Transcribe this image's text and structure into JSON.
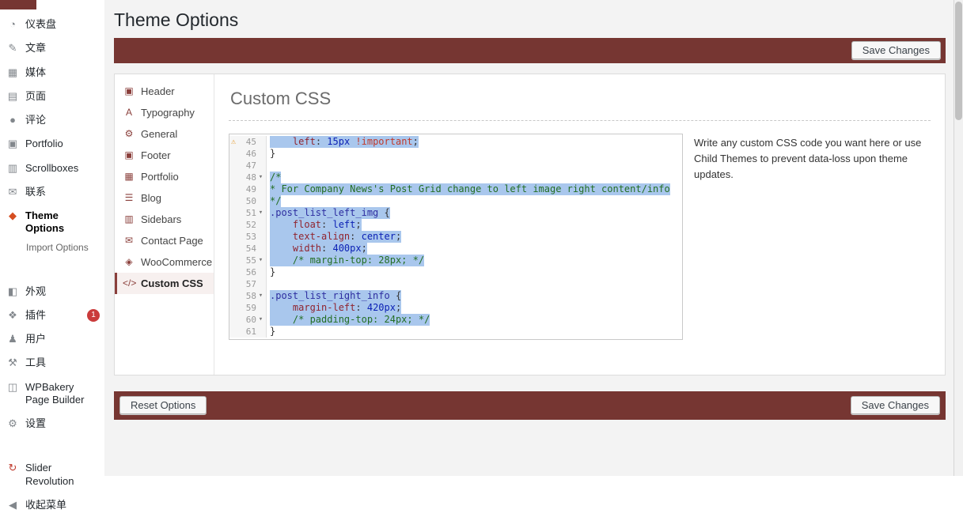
{
  "colors": {
    "accent_bar": "#763632",
    "selection": "#a9c7ed",
    "warning_icon": "#e8a33d",
    "badge": "#ca3b3b",
    "theme_options_icon": "#d54e21",
    "subnav_icon": "#8a3f3b"
  },
  "admin_sidebar": {
    "items": [
      {
        "id": "dashboard",
        "label": "仪表盘",
        "icon": "dashboard-icon",
        "glyph": "◔"
      },
      {
        "id": "posts",
        "label": "文章",
        "icon": "posts-icon",
        "glyph": "✎"
      },
      {
        "id": "media",
        "label": "媒体",
        "icon": "media-icon",
        "glyph": "▦"
      },
      {
        "id": "pages",
        "label": "页面",
        "icon": "pages-icon",
        "glyph": "▤"
      },
      {
        "id": "comments",
        "label": "评论",
        "icon": "comments-icon",
        "glyph": "●"
      },
      {
        "id": "portfolio",
        "label": "Portfolio",
        "icon": "portfolio-icon",
        "glyph": "▣"
      },
      {
        "id": "scrollboxes",
        "label": "Scrollboxes",
        "icon": "scrollboxes-icon",
        "glyph": "▥"
      },
      {
        "id": "contact",
        "label": "联系",
        "icon": "contact-icon",
        "glyph": "✉"
      },
      {
        "id": "theme-options",
        "label": "Theme Options",
        "icon": "theme-options-icon",
        "glyph": "◆",
        "icon_color": "#d54e21",
        "active": true
      },
      {
        "id": "import-options",
        "label": "Import Options",
        "submenu": true
      },
      {
        "id": "appearance",
        "label": "外观",
        "icon": "appearance-icon",
        "glyph": "◧",
        "gap": true
      },
      {
        "id": "plugins",
        "label": "插件",
        "icon": "plugins-icon",
        "glyph": "❖",
        "badge": "1"
      },
      {
        "id": "users",
        "label": "用户",
        "icon": "users-icon",
        "glyph": "♟"
      },
      {
        "id": "tools",
        "label": "工具",
        "icon": "tools-icon",
        "glyph": "⚒"
      },
      {
        "id": "wpbakery",
        "label": "WPBakery Page Builder",
        "icon": "wpbakery-icon",
        "glyph": "◫"
      },
      {
        "id": "settings",
        "label": "设置",
        "icon": "settings-icon",
        "glyph": "⚙"
      },
      {
        "id": "slider-revolution",
        "label": "Slider Revolution",
        "icon": "slider-revolution-icon",
        "glyph": "↻",
        "icon_color": "#c0392b",
        "gap": true
      },
      {
        "id": "collapse-menu",
        "label": "收起菜单",
        "icon": "collapse-menu-icon",
        "glyph": "◀"
      }
    ]
  },
  "theme_options": {
    "heading": "Theme Options",
    "save_button": "Save Changes",
    "reset_button": "Reset Options",
    "panel_title": "Custom CSS",
    "hint": "Write any custom CSS code you want here or use Child Themes to prevent data-loss upon theme updates.",
    "subnav": [
      {
        "id": "header",
        "label": "Header",
        "icon": "monitor-icon",
        "glyph": "▣"
      },
      {
        "id": "typography",
        "label": "Typography",
        "icon": "typography-icon",
        "glyph": "A"
      },
      {
        "id": "general",
        "label": "General",
        "icon": "gear-icon",
        "glyph": "⚙"
      },
      {
        "id": "footer",
        "label": "Footer",
        "icon": "monitor-icon",
        "glyph": "▣"
      },
      {
        "id": "portfolio",
        "label": "Portfolio",
        "icon": "briefcase-icon",
        "glyph": "▦"
      },
      {
        "id": "blog",
        "label": "Blog",
        "icon": "list-icon",
        "glyph": "☰"
      },
      {
        "id": "sidebars",
        "label": "Sidebars",
        "icon": "columns-icon",
        "glyph": "▥"
      },
      {
        "id": "contact-page",
        "label": "Contact Page",
        "icon": "envelope-icon",
        "glyph": "✉"
      },
      {
        "id": "woocommerce",
        "label": "WooCommerce",
        "icon": "tag-icon",
        "glyph": "◈"
      },
      {
        "id": "custom-css",
        "label": "Custom CSS",
        "icon": "code-icon",
        "glyph": "</>",
        "active": true
      }
    ],
    "editor": {
      "warning_glyph": "⚠",
      "fold_glyph": "▾",
      "lines": [
        {
          "n": 45,
          "marker": "warn",
          "sel": true,
          "t": [
            [
              "    ",
              "pl"
            ],
            [
              "left",
              "prop"
            ],
            [
              ": ",
              "pl"
            ],
            [
              "15px",
              "val"
            ],
            [
              " ",
              "pl"
            ],
            [
              "!important",
              "imp"
            ],
            [
              ";",
              "pl"
            ]
          ]
        },
        {
          "n": 46,
          "sel": false,
          "t": [
            [
              "}",
              "pl"
            ]
          ]
        },
        {
          "n": 47,
          "sel": false,
          "t": []
        },
        {
          "n": 48,
          "marker": "fold",
          "sel": true,
          "t": [
            [
              "/*",
              "cm"
            ]
          ]
        },
        {
          "n": 49,
          "sel": true,
          "t": [
            [
              "* For Company News's Post Grid change to left image right content/info",
              "cm"
            ]
          ]
        },
        {
          "n": 50,
          "sel": true,
          "t": [
            [
              "*/",
              "cm"
            ]
          ]
        },
        {
          "n": 51,
          "marker": "fold",
          "sel": true,
          "t": [
            [
              ".post_list_left_img",
              "sel2"
            ],
            [
              " ",
              "pl"
            ],
            [
              "{",
              "pl"
            ]
          ]
        },
        {
          "n": 52,
          "sel": true,
          "t": [
            [
              "    ",
              "pl"
            ],
            [
              "float",
              "prop"
            ],
            [
              ": ",
              "pl"
            ],
            [
              "left",
              "val"
            ],
            [
              ";",
              "pl"
            ]
          ]
        },
        {
          "n": 53,
          "sel": true,
          "t": [
            [
              "    ",
              "pl"
            ],
            [
              "text-align",
              "prop"
            ],
            [
              ": ",
              "pl"
            ],
            [
              "center",
              "val"
            ],
            [
              ";",
              "pl"
            ]
          ]
        },
        {
          "n": 54,
          "sel": true,
          "t": [
            [
              "    ",
              "pl"
            ],
            [
              "width",
              "prop"
            ],
            [
              ": ",
              "pl"
            ],
            [
              "400px",
              "val"
            ],
            [
              ";",
              "pl"
            ]
          ]
        },
        {
          "n": 55,
          "marker": "fold",
          "sel": true,
          "t": [
            [
              "    ",
              "pl"
            ],
            [
              "/* margin-top: 28px; */",
              "cm"
            ]
          ]
        },
        {
          "n": 56,
          "sel": false,
          "t": [
            [
              "}",
              "pl"
            ]
          ]
        },
        {
          "n": 57,
          "sel": false,
          "t": []
        },
        {
          "n": 58,
          "marker": "fold",
          "sel": true,
          "t": [
            [
              ".post_list_right_info",
              "sel2"
            ],
            [
              " ",
              "pl"
            ],
            [
              "{",
              "pl"
            ]
          ]
        },
        {
          "n": 59,
          "sel": true,
          "t": [
            [
              "    ",
              "pl"
            ],
            [
              "margin-left",
              "prop"
            ],
            [
              ": ",
              "pl"
            ],
            [
              "420px",
              "val"
            ],
            [
              ";",
              "pl"
            ]
          ]
        },
        {
          "n": 60,
          "marker": "fold",
          "sel": true,
          "t": [
            [
              "    ",
              "pl"
            ],
            [
              "/* padding-top: 24px; */",
              "cm"
            ]
          ]
        },
        {
          "n": 61,
          "sel": false,
          "t": [
            [
              "}",
              "pl"
            ]
          ]
        }
      ]
    }
  }
}
